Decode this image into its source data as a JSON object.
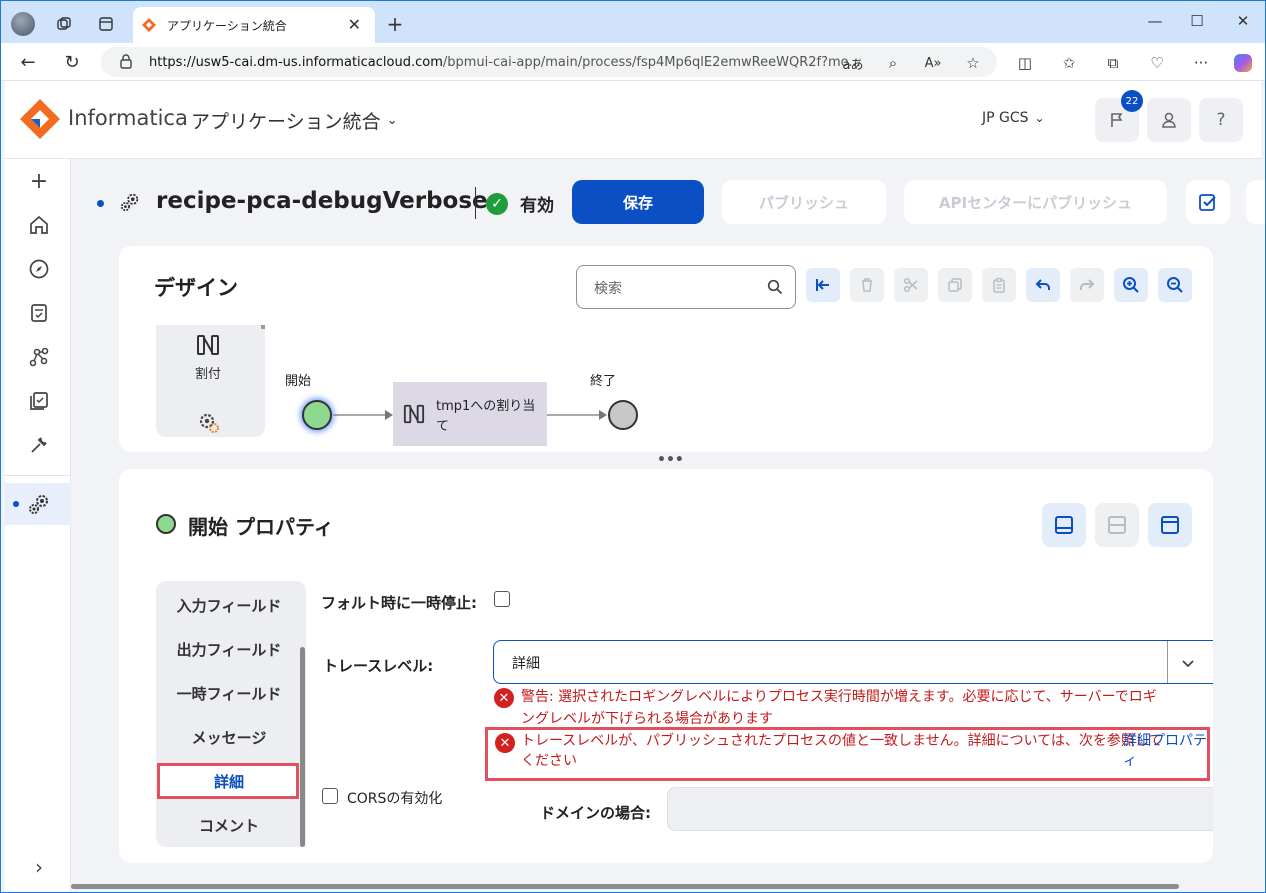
{
  "browser": {
    "tab_title": "アプリケーション統合",
    "url_host": "https://usw5-cai.dm-us.informaticacloud.com",
    "url_path": "/bpmui-cai-app/main/process/fsp4Mp6qlE2emwReeWQR2f?mo...",
    "read_aloud_label": "aあ"
  },
  "header": {
    "brand": "Informatica",
    "app_name": "アプリケーション統合",
    "org": "JP GCS",
    "notification_count": "22"
  },
  "process": {
    "name": "recipe-pca-debugVerbose",
    "status": "有効",
    "save_label": "保存",
    "publish_label": "パブリッシュ",
    "api_publish_label": "APIセンターにパブリッシュ"
  },
  "design": {
    "title": "デザイン",
    "search_placeholder": "検索",
    "palette_item": "割付",
    "start_label": "開始",
    "end_label": "終了",
    "node_label_line1": "tmp1への割り当",
    "node_label_line2": "て"
  },
  "properties": {
    "title": "開始 プロパティ",
    "nav": [
      "入力フィールド",
      "出力フィールド",
      "一時フィールド",
      "メッセージ",
      "詳細",
      "コメント"
    ],
    "fault_label": "フォルト時に一時停止:",
    "trace_label": "トレースレベル:",
    "trace_value": "詳細",
    "warn_line1": "警告: 選択されたロギングレベルによりプロセス実行時間が増えます。必要に応じて、サーバーでロギ",
    "warn_line2": "ングレベルが下げられる場合があります",
    "mismatch_line1": "トレースレベルが、パブリッシュされたプロセスの値と一致しません。詳細については、次を参照して",
    "mismatch_line2": "ください",
    "mismatch_link1": "詳細プロパテ",
    "mismatch_link2": "ィ",
    "cors_label": "CORSの有効化",
    "domain_label": "ドメインの場合:"
  },
  "colors": {
    "primary": "#0a4fc4",
    "error": "#d32020",
    "highlight": "#e0505f",
    "start_node": "#8fd88f",
    "valid": "#1f9d3a"
  }
}
